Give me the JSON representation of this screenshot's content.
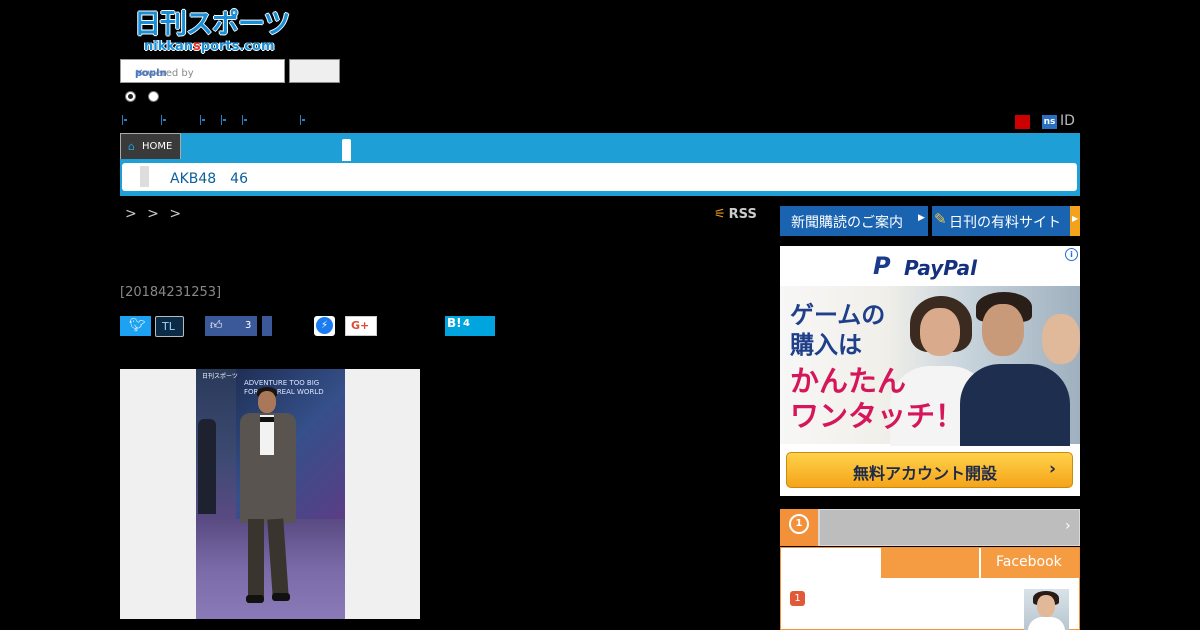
{
  "header": {
    "logo_jp": "日刊スポーツ",
    "logo_en_pre": "nikkan",
    "logo_en_red": "s",
    "logo_en_post": "ports.com",
    "search_placeholder_prefix": "powered by",
    "search_placeholder_brand": "popln",
    "search_button_label": "",
    "id_label": "ID",
    "ns_badge": "ns"
  },
  "nav": {
    "home_label": "HOME",
    "subnav_label": "AKB48　46"
  },
  "breadcrumb": {
    "text": "> > >"
  },
  "rss_label": "RSS",
  "article": {
    "date": "[20184231253]"
  },
  "social": {
    "tl_label": "TL",
    "facebook_count": "3",
    "google_plus_label": "G+",
    "hatena_label": "B!",
    "hatena_count": "4"
  },
  "photo": {
    "brand_label": "日刊スポーツ",
    "poster_text": "ADVENTURE TOO BIG\nFOR THE REAL WORLD"
  },
  "sidebar": {
    "subscribe_label": "新聞購読のご案内",
    "paid_site_label": "日刊の有料サイト",
    "ad": {
      "brand": "PayPal",
      "headline_1": "ゲームの",
      "headline_2": "購入は",
      "headline_3": "かんたん",
      "headline_4": "ワンタッチ！",
      "cta": "無料アカウント開設",
      "colors": {
        "brand_dark": "#15307e",
        "brand_light": "#1a8fd8",
        "accent": "#d6165a",
        "cta": "#f5a41a"
      }
    },
    "ranking": {
      "tab_facebook": "Facebook",
      "item_1_rank": "1"
    }
  },
  "colors": {
    "background": "#000000",
    "nav_blue": "#1e9fd6",
    "button_blue": "#1a63b0",
    "ranking_orange": "#f3913a"
  }
}
